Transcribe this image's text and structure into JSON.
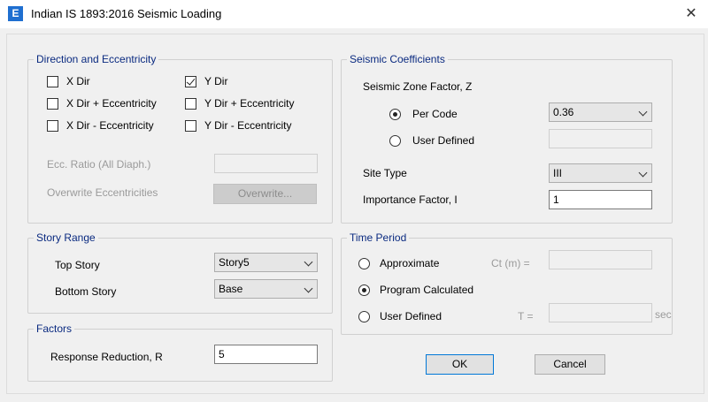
{
  "window": {
    "title": "Indian IS 1893:2016 Seismic Loading",
    "icon_letter": "E",
    "close_glyph": "✕"
  },
  "direction": {
    "legend": "Direction and Eccentricity",
    "checks": [
      {
        "label": "X Dir",
        "checked": false
      },
      {
        "label": "X Dir + Eccentricity",
        "checked": false
      },
      {
        "label": "X Dir - Eccentricity",
        "checked": false
      },
      {
        "label": "Y Dir",
        "checked": true
      },
      {
        "label": "Y Dir + Eccentricity",
        "checked": false
      },
      {
        "label": "Y Dir - Eccentricity",
        "checked": false
      }
    ],
    "ecc_ratio_label": "Ecc. Ratio (All Diaph.)",
    "ecc_ratio_value": "",
    "overwrite_label": "Overwrite Eccentricities",
    "overwrite_button": "Overwrite..."
  },
  "story_range": {
    "legend": "Story Range",
    "top_label": "Top Story",
    "top_value": "Story5",
    "bottom_label": "Bottom Story",
    "bottom_value": "Base"
  },
  "factors": {
    "legend": "Factors",
    "r_label": "Response Reduction, R",
    "r_value": "5"
  },
  "seismic": {
    "legend": "Seismic Coefficients",
    "zone_label": "Seismic Zone Factor, Z",
    "per_code_label": "Per Code",
    "per_code_value": "0.36",
    "user_defined_label": "User Defined",
    "user_defined_value": "",
    "site_type_label": "Site Type",
    "site_type_value": "III",
    "importance_label": "Importance Factor, I",
    "importance_value": "1"
  },
  "time_period": {
    "legend": "Time Period",
    "approximate_label": "Approximate",
    "ct_label": "Ct (m) =",
    "ct_value": "",
    "program_label": "Program Calculated",
    "user_label": "User Defined",
    "t_label": "T =",
    "t_value": "",
    "sec_label": "sec",
    "selected": "program"
  },
  "buttons": {
    "ok": "OK",
    "cancel": "Cancel"
  },
  "colors": {
    "legend_text": "#0a2a80",
    "icon_bg": "#1f6fd0",
    "default_button_border": "#0078d7"
  }
}
